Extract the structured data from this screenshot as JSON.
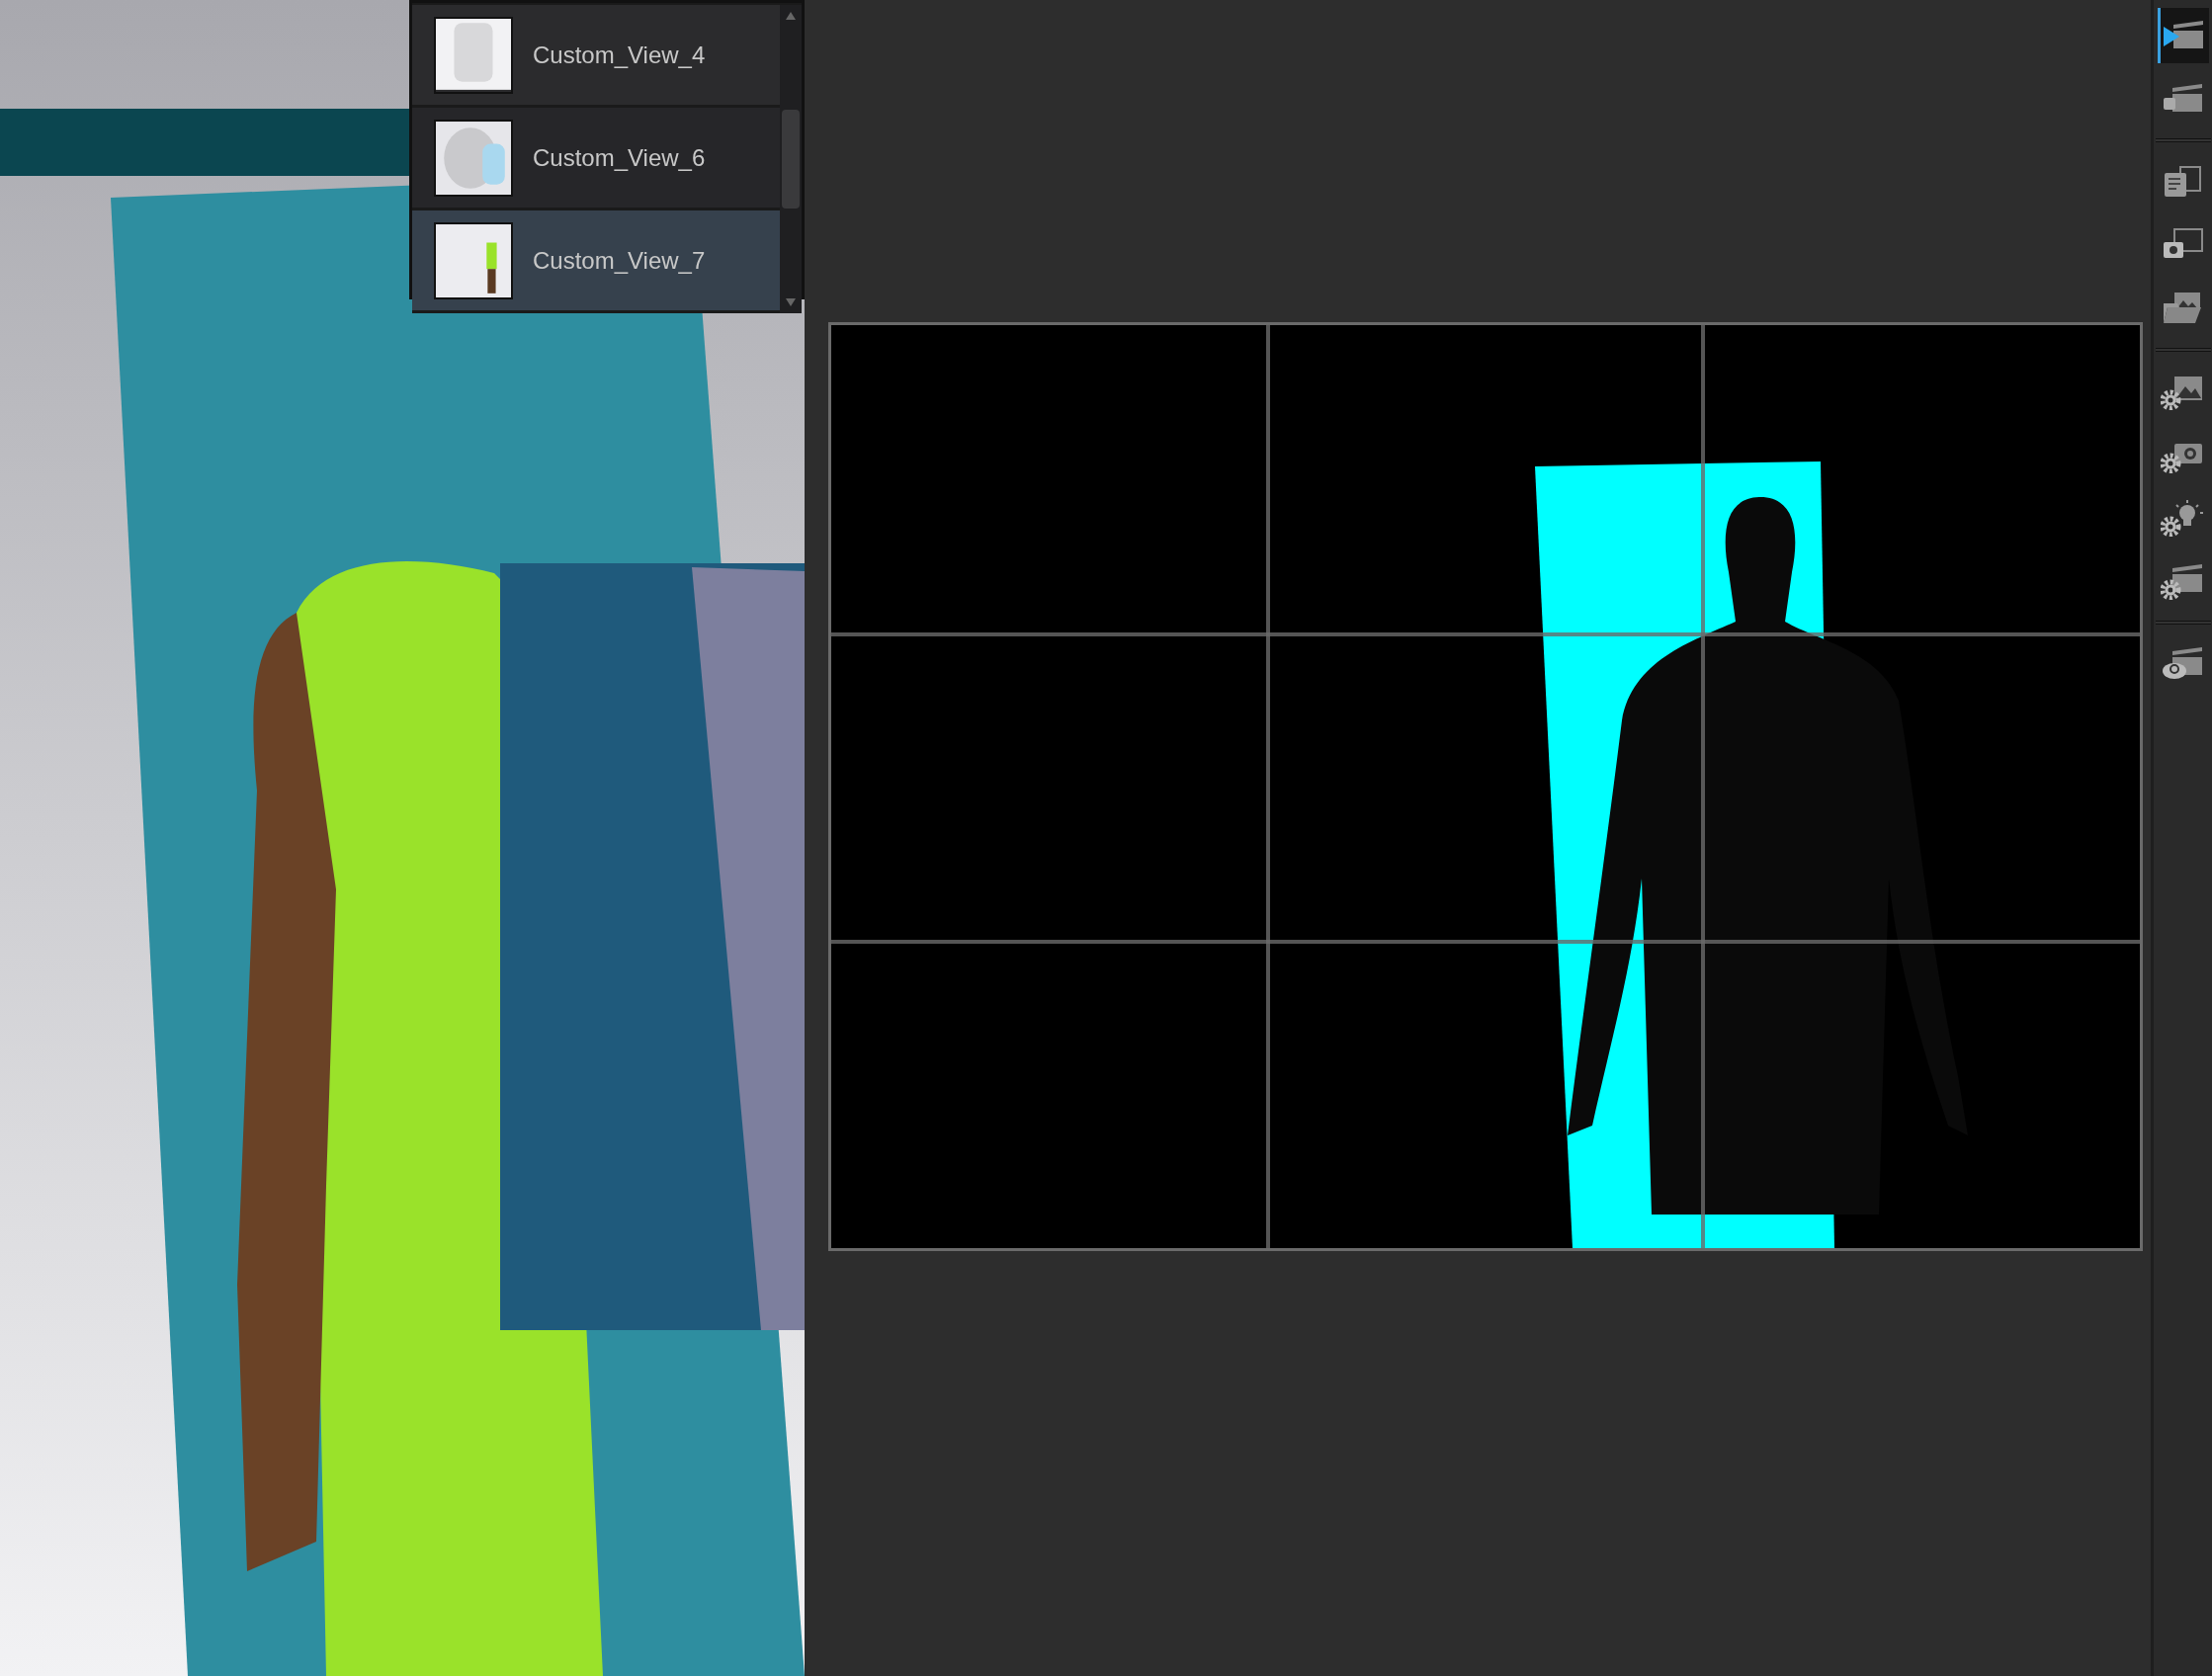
{
  "view_list": {
    "items": [
      {
        "label": "Custom_View_4",
        "selected": false
      },
      {
        "label": "Custom_View_6",
        "selected": false
      },
      {
        "label": "Custom_View_7",
        "selected": true
      }
    ]
  },
  "toolbar": {
    "groups": [
      {
        "items": [
          {
            "selected": true
          },
          {
            "selected": false
          }
        ]
      },
      {
        "items": [
          {
            "selected": false
          },
          {
            "selected": false
          },
          {
            "selected": false
          }
        ]
      },
      {
        "items": [
          {
            "selected": false
          },
          {
            "selected": false
          },
          {
            "selected": false
          },
          {
            "selected": false
          }
        ]
      },
      {
        "items": [
          {
            "selected": false
          }
        ]
      }
    ]
  }
}
